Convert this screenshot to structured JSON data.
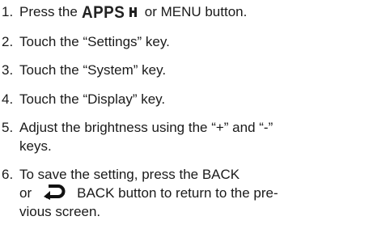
{
  "steps": [
    {
      "number": "1.",
      "text_before": "Press the",
      "apps_label": "APPS",
      "text_after": "or MENU button."
    },
    {
      "number": "2.",
      "text": "Touch the “Settings” key."
    },
    {
      "number": "3.",
      "text": "Touch the “System” key."
    },
    {
      "number": "4.",
      "text": "Touch the “Display” key."
    },
    {
      "number": "5.",
      "line1": "Adjust the brightness using the “+” and “-”",
      "line2": "keys."
    },
    {
      "number": "6.",
      "line1": "To save the setting, press the BACK",
      "line2_before": "or",
      "line2_after": "BACK button to return to the pre-",
      "line3": "vious screen."
    }
  ],
  "icons": {
    "apps": "apps-icon",
    "back": "back-arrow-icon"
  }
}
